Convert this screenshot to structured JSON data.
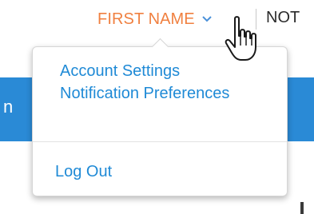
{
  "header": {
    "user_name": "FIRST NAME",
    "next_nav_partial": "NOT"
  },
  "background": {
    "left_band_text": "n"
  },
  "user_menu": {
    "items": [
      {
        "label": "Account Settings"
      },
      {
        "label": "Notification Preferences"
      }
    ],
    "logout_label": "Log Out"
  },
  "colors": {
    "user_name": "#f08040",
    "menu_link": "#1f8ad6",
    "band": "#2a8ad6"
  },
  "icons": {
    "chevron": "chevron-down-icon",
    "cursor": "hand-pointer-cursor"
  }
}
